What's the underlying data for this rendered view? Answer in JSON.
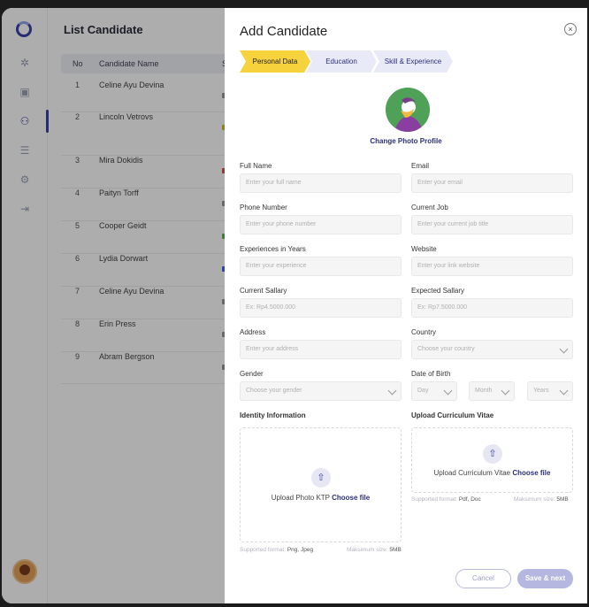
{
  "background": {
    "title": "List Candidate",
    "columns": [
      "No",
      "Candidate Name",
      "S"
    ],
    "rows": [
      {
        "no": "1",
        "name": "Celine Ayu Devina",
        "tag_color": "#9a9a9a"
      },
      {
        "no": "2",
        "name": "Lincoln Vetrovs",
        "tag_color": "#e3b63a"
      },
      {
        "no": "3",
        "name": "Mira Dokidis",
        "tag_color": "#d9534f"
      },
      {
        "no": "4",
        "name": "Paityn Torff",
        "tag_color": "#9a9a9a"
      },
      {
        "no": "5",
        "name": "Cooper Geidt",
        "tag_color": "#5cb85c"
      },
      {
        "no": "6",
        "name": "Lydia Dorwart",
        "tag_color": "#3b6fd9"
      },
      {
        "no": "7",
        "name": "Celine Ayu Devina",
        "tag_color": "#9a9a9a"
      },
      {
        "no": "8",
        "name": "Erin Press",
        "tag_color": "#9a9a9a"
      },
      {
        "no": "9",
        "name": "Abram Bergson",
        "tag_color": "#9a9a9a"
      }
    ]
  },
  "drawer": {
    "title": "Add Candidate",
    "close": "×",
    "steps": [
      {
        "label": "Personal Data",
        "active": true
      },
      {
        "label": "Education",
        "active": false
      },
      {
        "label": "Skill & Experience",
        "active": false
      }
    ],
    "change_photo": "Change Photo Profile",
    "fields": {
      "full_name": {
        "label": "Full Name",
        "placeholder": "Enter your full name"
      },
      "email": {
        "label": "Email",
        "placeholder": "Enter your email"
      },
      "phone": {
        "label": "Phone Number",
        "placeholder": "Enter your phone number"
      },
      "current_job": {
        "label": "Current Job",
        "placeholder": "Enter your current job title"
      },
      "experience": {
        "label": "Experiences in Years",
        "placeholder": "Enter your experience"
      },
      "website": {
        "label": "Website",
        "placeholder": "Enter your link website"
      },
      "current_salary": {
        "label": "Current Sallary",
        "placeholder": "Ex: Rp4.5000.000"
      },
      "expected_salary": {
        "label": "Expected Sallary",
        "placeholder": "Ex: Rp7.5000.000"
      },
      "address": {
        "label": "Address",
        "placeholder": "Enter your address"
      },
      "country": {
        "label": "Country",
        "placeholder": "Choose your country"
      },
      "gender": {
        "label": "Gender",
        "placeholder": "Choose your gender"
      },
      "dob": {
        "label": "Date of Birth",
        "day": "Day",
        "month": "Month",
        "year": "Years"
      }
    },
    "identity": {
      "title": "Identity Information",
      "upload_text": "Upload Photo KTP",
      "choose": "Choose file",
      "format_label": "Supported format:",
      "format_value": "Png, Jpeg",
      "size_label": "Maksimum size:",
      "size_value": "5MB"
    },
    "cv": {
      "title": "Upload Curriculum Vitae",
      "upload_text": "Upload Curriculum Vitae",
      "choose": "Choose file",
      "format_label": "Supported format:",
      "format_value": "Pdf, Doc",
      "size_label": "Maksimum size:",
      "size_value": "5MB"
    },
    "cancel": "Cancel",
    "save": "Save & next"
  },
  "colors": {
    "step_active": "#f6d23c",
    "step_inactive": "#e9eaf7",
    "primary": "#2d2f7a",
    "save_button": "#b5b7e0"
  }
}
